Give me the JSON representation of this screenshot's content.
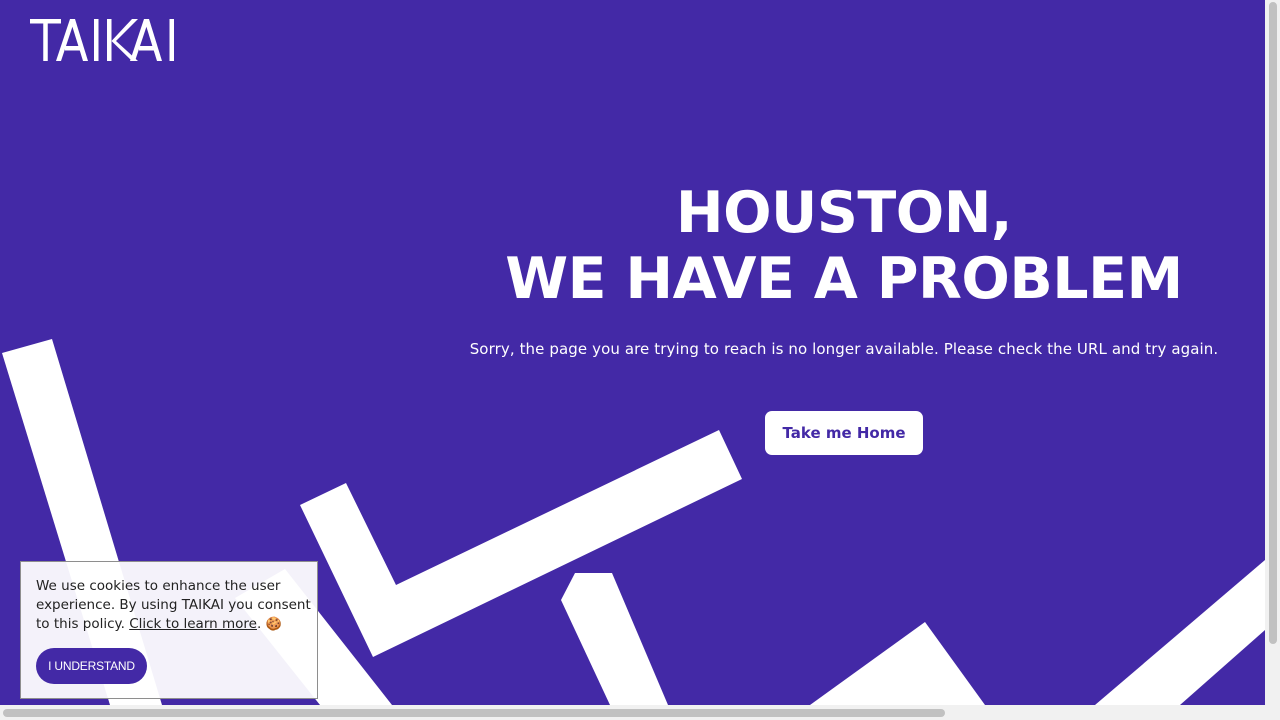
{
  "colors": {
    "brand": "#4329a6",
    "background": "#4329a6",
    "button_bg": "#ffffff",
    "text": "#ffffff"
  },
  "header": {
    "logo_text": "TAIKAI"
  },
  "hero": {
    "headline_line1": "HOUSTON,",
    "headline_line2": "WE HAVE A PROBLEM",
    "message": "Sorry, the page you are trying to reach is no longer available. Please check the URL and try again.",
    "home_button_label": "Take me Home"
  },
  "cookie_banner": {
    "text": "We use cookies to enhance the user experience. By using TAIKAI you consent to this policy.",
    "link_text": "Click to learn more",
    "emoji": "🍪",
    "button_label": "I understand"
  },
  "icons": {
    "logo": "taikai-logo",
    "cookie": "cookie-icon"
  }
}
